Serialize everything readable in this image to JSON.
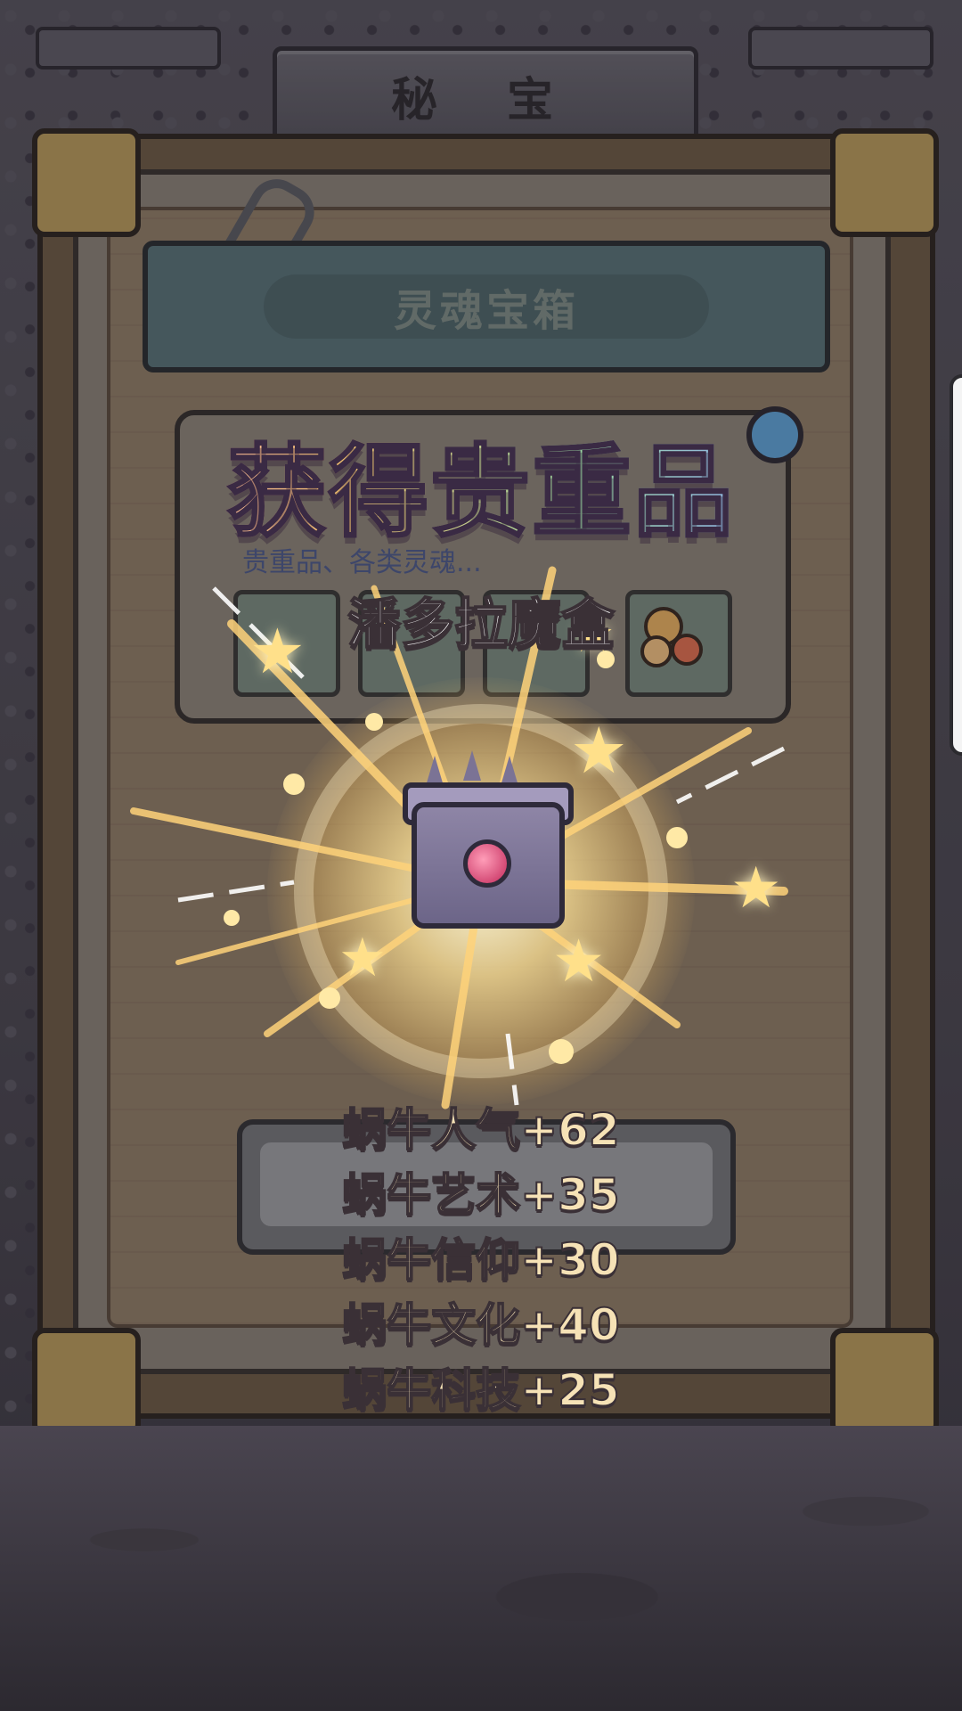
{
  "header": {
    "title": "秘 宝"
  },
  "category": {
    "label": "灵魂宝箱"
  },
  "background_card": {
    "subtitle": "贵重品、各类灵魂..."
  },
  "popup": {
    "title": "获得贵重品",
    "item_name": "潘多拉魔盒",
    "stats": [
      "蜗牛人气+62",
      "蜗牛艺术+35",
      "蜗牛信仰+30",
      "蜗牛文化+40",
      "蜗牛科技+25"
    ]
  },
  "icons": {
    "chest": "pandora-box-icon",
    "stars": "sparkle-star-icon",
    "help": "help-icon"
  },
  "colors": {
    "stat_text": "#f6e2b6",
    "glow": "#ffe08a",
    "category_bar": "#587277"
  }
}
